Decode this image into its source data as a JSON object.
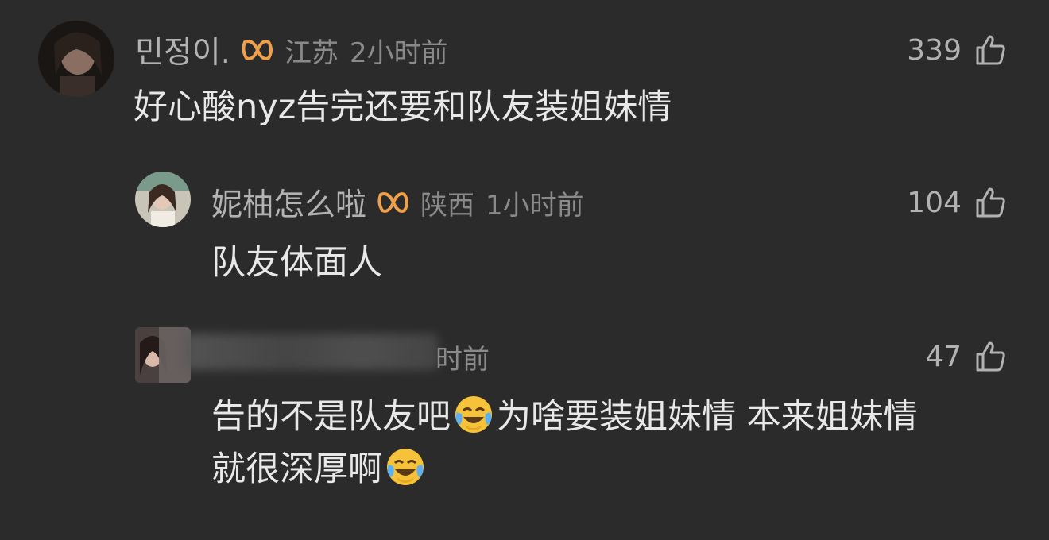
{
  "comments": [
    {
      "username": "민정이.",
      "location": "江苏",
      "time": "2小时前",
      "likes": "339",
      "text": "好心酸nyz告完还要和队友装姐妹情"
    },
    {
      "username": "妮柚怎么啦",
      "location": "陕西",
      "time": "1小时前",
      "likes": "104",
      "text": "队友体面人"
    },
    {
      "username": "",
      "time_visible": "时前",
      "likes": "47",
      "text_part1": "告的不是队友吧",
      "text_part2": "为啥要装姐妹情 本来姐妹情",
      "text_part3": "就很深厚啊"
    }
  ],
  "icons": {
    "badge": "vip-badge-icon",
    "like": "thumbs-up-icon",
    "emoji": "face-with-tears-of-joy-emoji"
  },
  "colors": {
    "background": "#2b2b2b",
    "badge_orange": "#f0a04a"
  }
}
